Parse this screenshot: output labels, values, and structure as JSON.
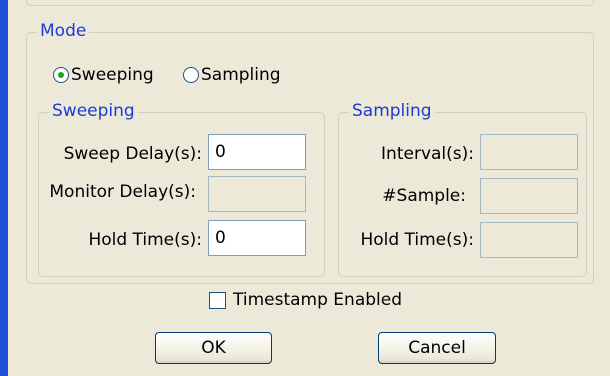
{
  "mode": {
    "title": "Mode",
    "options": [
      {
        "label": "Sweeping",
        "selected": true
      },
      {
        "label": "Sampling",
        "selected": false
      }
    ]
  },
  "sweeping": {
    "title": "Sweeping",
    "sweep_delay_label": "Sweep Delay(s):",
    "sweep_delay_value": "0",
    "monitor_delay_label": "Monitor Delay(s):",
    "monitor_delay_value": "",
    "hold_time_label": "Hold Time(s):",
    "hold_time_value": "0"
  },
  "sampling": {
    "title": "Sampling",
    "interval_label": "Interval(s):",
    "interval_value": "",
    "sample_label": "#Sample:",
    "sample_value": "",
    "hold_time_label": "Hold Time(s):",
    "hold_time_value": ""
  },
  "timestamp": {
    "label": "Timestamp Enabled",
    "checked": false
  },
  "buttons": {
    "ok": "OK",
    "cancel": "Cancel"
  },
  "colors": {
    "legend_text": "#1c3ad6",
    "window_border": "#1f4fd6",
    "background": "#ece9d8",
    "radio_dot": "#21a121"
  }
}
